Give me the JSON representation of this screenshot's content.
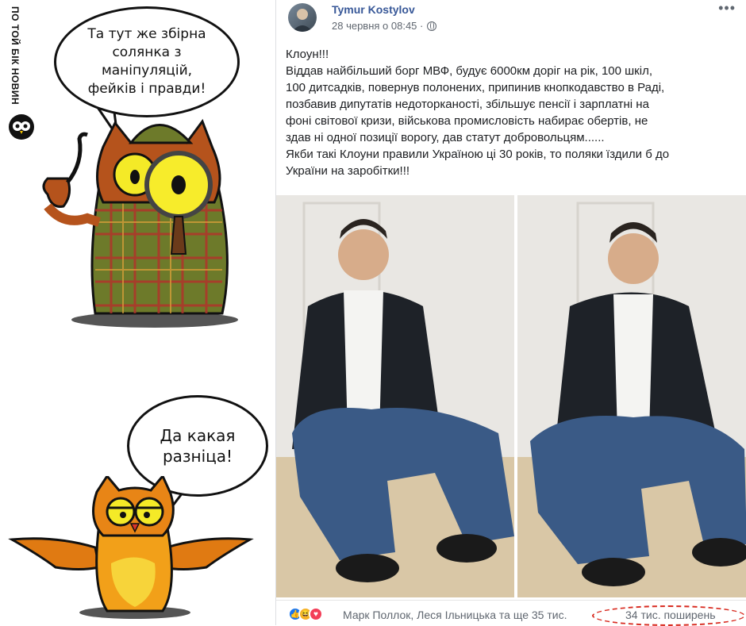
{
  "brand": {
    "name": "ПО ТОЙ БІК НОВИН"
  },
  "bubbles": {
    "top": [
      "Та тут же збірна",
      "солянка з",
      "маніпуляцій,",
      "фейків і правди!"
    ],
    "bottom": [
      "Да какая",
      "разніца!"
    ]
  },
  "post": {
    "author": "Tymur Kostylov",
    "timestamp": "28 червня о 08:45 ·",
    "privacy_icon": "globe-icon",
    "more_label": "•••",
    "text": [
      "Клоун!!!",
      "Віддав найбільший борг МВФ, будує 6000км доріг на рік, 100 шкіл,",
      "100 дитсадків, повернув полонених, припинив кнопкодавство в Раді,",
      "позбавив дипутатів недоторканості, збільшує пенсії і зарплатні на",
      "фоні світової кризи, військова промисловість набирає обертів, не",
      "здав ні одної позиції ворогу, дав статут добровольцям......",
      "Якби такі Клоуни правили Україною ці 30 років, то поляки їздили б до",
      "України на заробітки!!!"
    ],
    "reactions": [
      "like-icon",
      "haha-icon",
      "love-icon"
    ],
    "reaction_names": "Марк Поллок, Леся Ільницька та ще 35 тис.",
    "shares": "34 тис. поширень"
  },
  "colors": {
    "link": "#385898",
    "annotation": "#d82a1f",
    "muted": "#606770"
  }
}
